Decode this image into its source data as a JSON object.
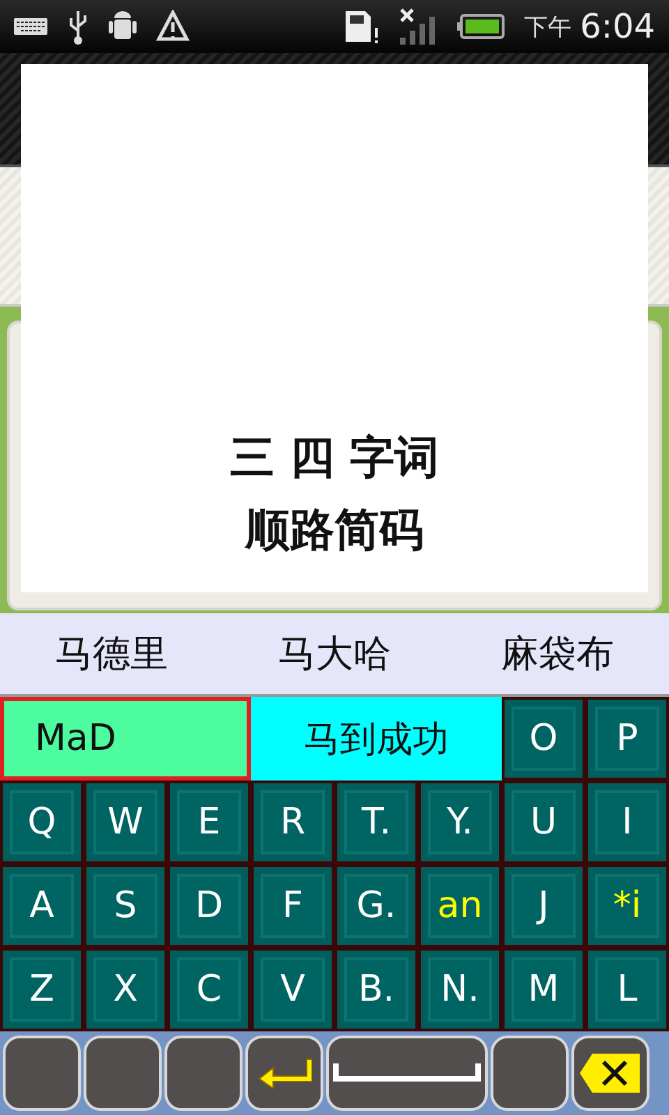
{
  "status_bar": {
    "period": "下午",
    "time": "6:04"
  },
  "popup": {
    "lines": [
      "三 四 字词",
      "顺路简码"
    ]
  },
  "candidates": [
    "马德里",
    "马大哈",
    "麻袋布"
  ],
  "composition": {
    "input": "MaD",
    "candidate": "马到成功"
  },
  "key_rows": [
    [
      {
        "label": "O",
        "highlighted": false
      },
      {
        "label": "P",
        "highlighted": false
      }
    ],
    [
      {
        "label": "Q",
        "highlighted": false
      },
      {
        "label": "W",
        "highlighted": false
      },
      {
        "label": "E",
        "highlighted": false
      },
      {
        "label": "R",
        "highlighted": false
      },
      {
        "label": "T.",
        "highlighted": false
      },
      {
        "label": "Y.",
        "highlighted": false
      },
      {
        "label": "U",
        "highlighted": false
      },
      {
        "label": "I",
        "highlighted": false
      }
    ],
    [
      {
        "label": "A",
        "highlighted": false
      },
      {
        "label": "S",
        "highlighted": false
      },
      {
        "label": "D",
        "highlighted": false
      },
      {
        "label": "F",
        "highlighted": false
      },
      {
        "label": "G.",
        "highlighted": false
      },
      {
        "label": "an",
        "highlighted": true
      },
      {
        "label": "J",
        "highlighted": false
      },
      {
        "label": "*i",
        "highlighted": true
      }
    ],
    [
      {
        "label": "Z",
        "highlighted": false
      },
      {
        "label": "X",
        "highlighted": false
      },
      {
        "label": "C",
        "highlighted": false
      },
      {
        "label": "V",
        "highlighted": false
      },
      {
        "label": "B.",
        "highlighted": false
      },
      {
        "label": "N.",
        "highlighted": false
      },
      {
        "label": "M",
        "highlighted": false
      },
      {
        "label": "L",
        "highlighted": false
      }
    ]
  ],
  "function_keys": [
    {
      "kind": "blank"
    },
    {
      "kind": "blank"
    },
    {
      "kind": "blank"
    },
    {
      "kind": "enter"
    },
    {
      "kind": "space"
    },
    {
      "kind": "blank"
    },
    {
      "kind": "backspace"
    }
  ]
}
